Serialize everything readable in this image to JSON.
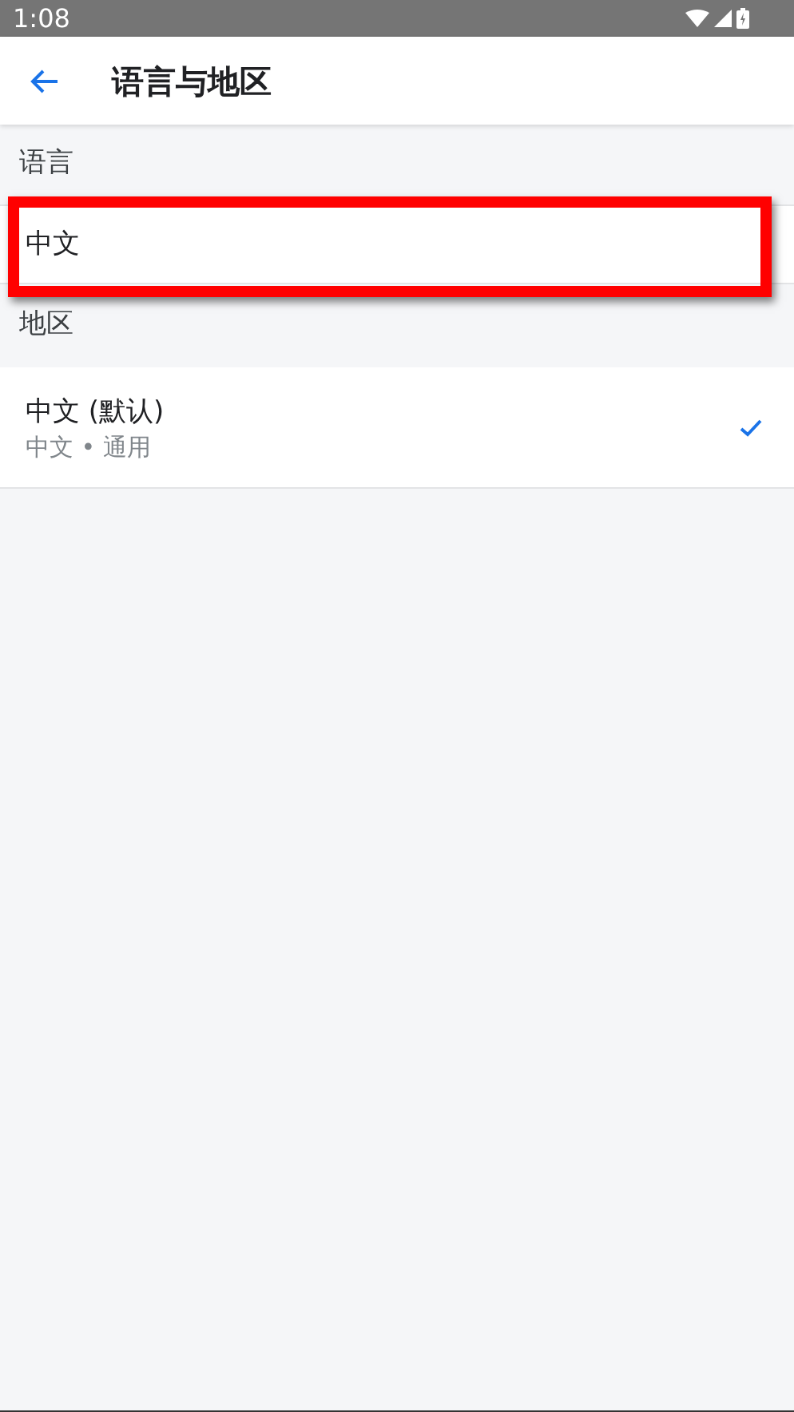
{
  "status_bar": {
    "time": "1:08"
  },
  "app_bar": {
    "title": "语言与地区"
  },
  "sections": [
    {
      "header": "语言",
      "items": [
        {
          "title": "中文",
          "highlighted": true,
          "selected": false
        }
      ]
    },
    {
      "header": "地区",
      "items": [
        {
          "title": "中文 (默认)",
          "subtitle": "中文 • 通用",
          "highlighted": false,
          "selected": true
        }
      ]
    }
  ]
}
